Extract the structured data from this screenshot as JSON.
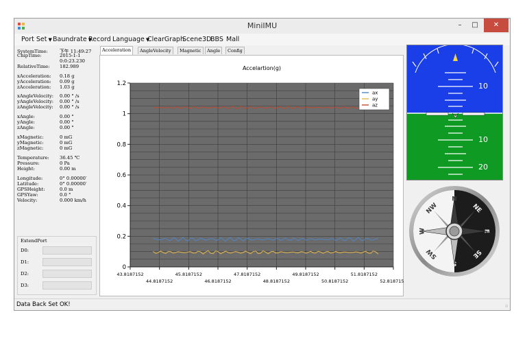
{
  "window": {
    "title": "MiniIMU",
    "min_glyph": "–",
    "max_glyph": "□",
    "close_glyph": "✕"
  },
  "menu": [
    {
      "label": "Port Set",
      "dropdown": true
    },
    {
      "label": "Baundrate",
      "dropdown": true
    },
    {
      "label": "Record",
      "dropdown": false
    },
    {
      "label": "Language",
      "dropdown": true
    },
    {
      "label": "ClearGraph",
      "dropdown": false
    },
    {
      "label": "Scene3D",
      "dropdown": false
    },
    {
      "label": "BBS",
      "dropdown": false
    },
    {
      "label": "Mall",
      "dropdown": false
    }
  ],
  "readouts": [
    {
      "label": "SystemTime:",
      "value": "下午 11:49:27"
    },
    {
      "label": "ChipTime:",
      "value": "2015-1-1"
    },
    {
      "label": "",
      "value": "0:0:23.230"
    },
    {
      "label": "RelativeTime:",
      "value": "182.989"
    },
    {
      "label": "xAcceleration:",
      "value": "0.18 g"
    },
    {
      "label": "yAcceleration:",
      "value": "0.09 g"
    },
    {
      "label": "zAcceleration:",
      "value": "1.03 g"
    },
    {
      "label": "xAngleVelocity:",
      "value": "0.00 ° /s"
    },
    {
      "label": "yAngleVelocity:",
      "value": "0.00 ° /s"
    },
    {
      "label": "zAngleVelocity:",
      "value": "0.00 ° /s"
    },
    {
      "label": "xAngle:",
      "value": "0.00 °"
    },
    {
      "label": "yAngle:",
      "value": "0.00 °"
    },
    {
      "label": "zAngle:",
      "value": "0.00 °"
    },
    {
      "label": "xMagnetic:",
      "value": "0 mG"
    },
    {
      "label": "yMagnetic:",
      "value": "0 mG"
    },
    {
      "label": "zMagnetic:",
      "value": "0 mG"
    },
    {
      "label": "Temperature:",
      "value": "36.45 ℃"
    },
    {
      "label": "Pressure:",
      "value": "0 Pa"
    },
    {
      "label": "Height:",
      "value": "0.00 m"
    },
    {
      "label": "Longitude:",
      "value": "0° 0.00000′"
    },
    {
      "label": "Latitude:",
      "value": "0° 0.00000′"
    },
    {
      "label": "GPSHeight:",
      "value": "0.0 m"
    },
    {
      "label": "GPSYaw:",
      "value": "0.0 °"
    },
    {
      "label": "Velocity:",
      "value": "0.000 km/h"
    }
  ],
  "extend_port": {
    "title": "ExtendPort",
    "ports": [
      "D0:",
      "D1:",
      "D2:",
      "D3:"
    ]
  },
  "tabs": [
    "Acceleration",
    "AngleVelocity",
    "Magnetic",
    "Angle",
    "Config"
  ],
  "active_tab": 0,
  "chart_data": {
    "type": "line",
    "title": "Accelartion(g)",
    "xlim": [
      43.8187152,
      52.8187152
    ],
    "ylim": [
      0,
      1.2
    ],
    "x_ticks_upper": [
      "43.8187152",
      "45.8187152",
      "47.8187152",
      "49.8187152",
      "51.8187152"
    ],
    "x_ticks_lower": [
      "44.8187152",
      "46.8187152",
      "48.8187152",
      "50.8187152",
      "52.8187152"
    ],
    "y_ticks": [
      "0",
      "0.2",
      "0.4",
      "0.6",
      "0.8",
      "1",
      "1.2"
    ],
    "grid": true,
    "legend": "top-right",
    "background": "#6b6b6b",
    "series": [
      {
        "name": "ax",
        "color": "#4f86c6",
        "mean": 0.18,
        "noise": 0.007
      },
      {
        "name": "ay",
        "color": "#e6b84a",
        "mean": 0.095,
        "noise": 0.006
      },
      {
        "name": "az",
        "color": "#c0492e",
        "mean": 1.04,
        "noise": 0.005
      }
    ]
  },
  "horizon": {
    "sky_color": "#1a3ee8",
    "ground_color": "#0e9a23",
    "labels": [
      "10",
      "10",
      "20"
    ]
  },
  "compass": {
    "letters": [
      "N",
      "NE",
      "E",
      "SE",
      "S",
      "SW",
      "W",
      "NW"
    ]
  },
  "status": "Data Back Set OK!",
  "grip_glyph": "⁞⁞"
}
